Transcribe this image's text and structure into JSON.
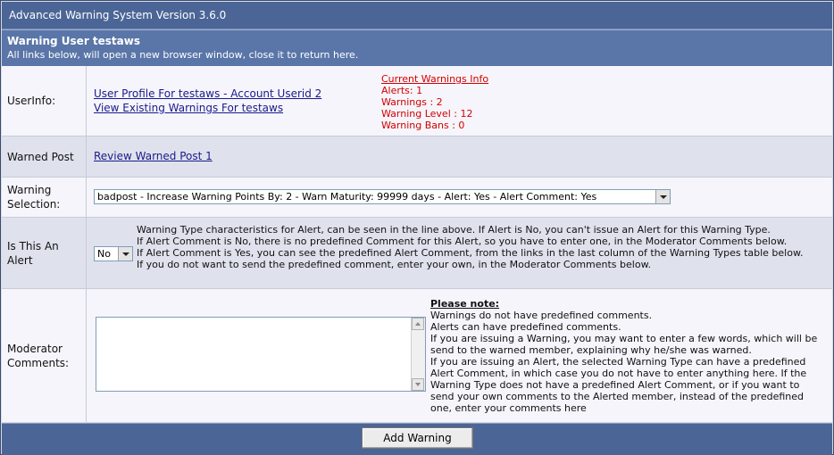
{
  "window_title": "Advanced Warning System Version 3.6.0",
  "header": {
    "title": "Warning User testaws",
    "subtitle": "All links below, will open a new browser window, close it to return here."
  },
  "userinfo": {
    "label": "UserInfo:",
    "profile_link": "User Profile For testaws - Account Userid 2",
    "warnings_link": "View Existing Warnings For testaws",
    "current_info_link": "Current Warnings Info",
    "alerts": "Alerts: 1",
    "warnings": "Warnings : 2",
    "warning_level": "Warning Level : 12",
    "warning_bans": "Warning Bans : 0"
  },
  "warned_post": {
    "label": "Warned Post",
    "link": "Review Warned Post 1"
  },
  "warning_selection": {
    "label": "Warning Selection:",
    "selected": "badpost - Increase Warning Points By: 2 - Warn Maturity: 99999 days - Alert: Yes - Alert Comment: Yes"
  },
  "alert": {
    "label": "Is This An Alert",
    "selected": "No",
    "help": [
      "Warning Type characteristics for Alert, can be seen in the line above. If Alert is No, you can't issue an Alert for this Warning Type.",
      "If Alert Comment is No, there is no predefined Comment for this Alert, so you have to enter one, in the Moderator Comments below.",
      "If Alert Comment is Yes, you can see the predefined Alert Comment, from the links in the last column of the Warning Types table below.",
      "If you do not want to send the predefined comment, enter your own, in the Moderator Comments below."
    ]
  },
  "moderator_comments": {
    "label": "Moderator Comments:",
    "value": "",
    "note_title": "Please note:",
    "note_lines": [
      "Warnings do not have predefined comments.",
      "Alerts can have predefined comments.",
      "If you are issuing a Warning, you may want to enter a few words, which will be send to the warned member, explaining why he/she was warned.",
      "If you are issuing an Alert, the selected Warning Type can have a predefined Alert Comment, in which case you do not have to enter anything here. If the Warning Type does not have a predefined Alert Comment, or if you want to send your own comments to the Alerted member, instead of the predefined one, enter your comments here"
    ]
  },
  "footer": {
    "add_button": "Add Warning"
  },
  "colors": {
    "title_bar": "#4b6596",
    "header": "#5a76a8",
    "link": "#1a1a8c",
    "warning_info": "#d40000"
  }
}
